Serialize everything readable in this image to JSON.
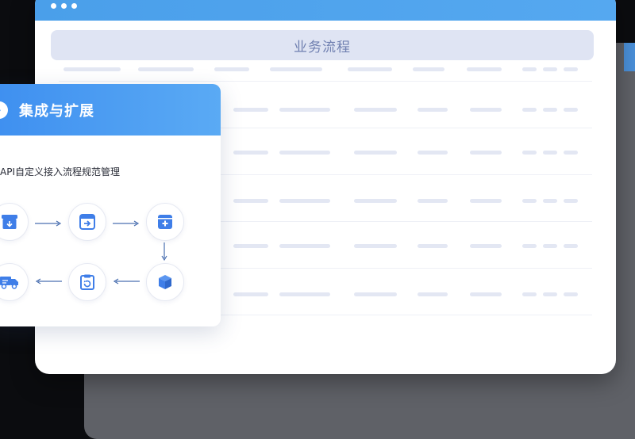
{
  "window": {
    "header_title": "业务流程"
  },
  "card": {
    "title": "集成与扩展",
    "subtitle": "API自定义接入流程规范管理",
    "flow_nodes": [
      {
        "name": "download-box-icon"
      },
      {
        "name": "login-box-icon"
      },
      {
        "name": "add-box-icon"
      },
      {
        "name": "cube-icon"
      },
      {
        "name": "clipboard-refresh-icon"
      },
      {
        "name": "delivery-truck-icon"
      }
    ]
  },
  "colors": {
    "accent": "#4a9fea",
    "header_bar": "#dfe4f3",
    "icon": "#3f7ee8"
  }
}
